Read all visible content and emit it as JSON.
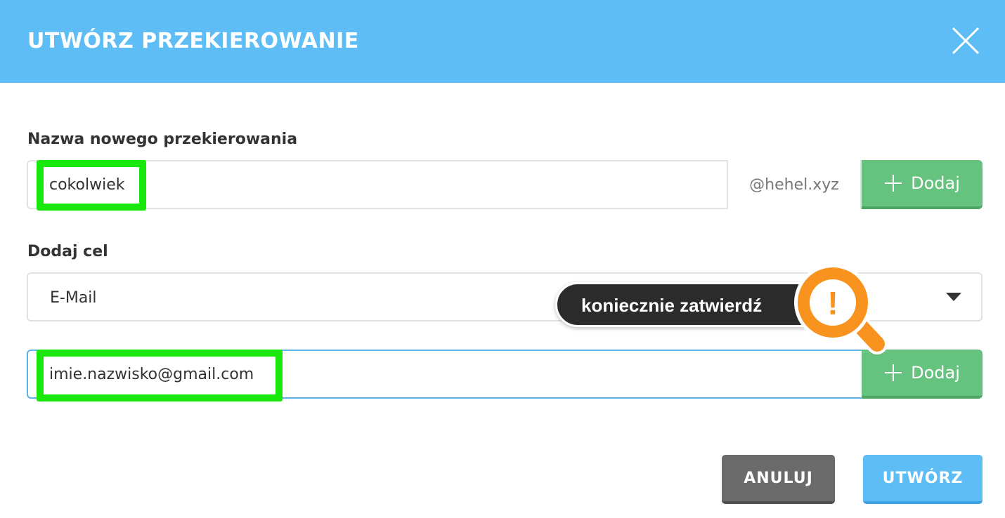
{
  "header": {
    "title": "UTWÓRZ PRZEKIEROWANIE"
  },
  "forward_name": {
    "label": "Nazwa nowego przekierowania",
    "value": "cokolwiek",
    "domain": "@hehel.xyz",
    "add_label": "Dodaj"
  },
  "target": {
    "label": "Dodaj cel",
    "type_selected": "E-Mail",
    "email_value": "imie.nazwisko@gmail.com",
    "add_label": "Dodaj"
  },
  "annotation": {
    "tooltip_text": "koniecznie zatwierdź",
    "badge_symbol": "!"
  },
  "footer": {
    "cancel_label": "ANULUJ",
    "create_label": "UTWÓRZ"
  },
  "colors": {
    "header_bg": "#5fbdf5",
    "add_button": "#66c27f",
    "cancel_button": "#6b6b6b",
    "create_button": "#5fbdf5",
    "highlight": "#19e80d",
    "warning": "#f7931e"
  }
}
